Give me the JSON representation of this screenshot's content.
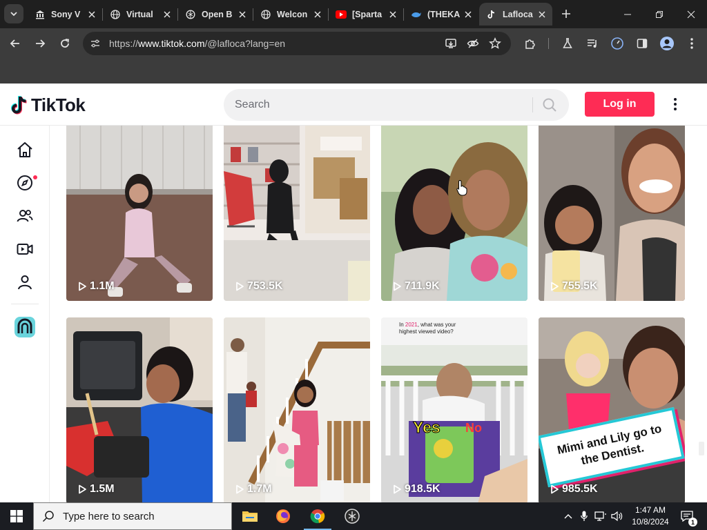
{
  "browser": {
    "tabs": [
      {
        "title": "Sony V",
        "favicon": "bank-icon"
      },
      {
        "title": "Virtual",
        "favicon": "globe-icon"
      },
      {
        "title": "Open B",
        "favicon": "chatgpt-icon"
      },
      {
        "title": "Welcon",
        "favicon": "globe-icon"
      },
      {
        "title": "[Sparta",
        "favicon": "youtube-icon"
      },
      {
        "title": "(THEKA",
        "favicon": "whale-icon"
      },
      {
        "title": "Lafloca",
        "favicon": "tiktok-icon",
        "active": true
      }
    ],
    "url_prefix": "https://",
    "url_domain": "www.tiktok.com",
    "url_path": "/@lafloca?lang=en"
  },
  "tiktok": {
    "logo_text": "TikTok",
    "search_placeholder": "Search",
    "login_label": "Log in"
  },
  "sidebar": {
    "items": [
      "home-icon",
      "explore-icon",
      "following-icon",
      "live-icon",
      "profile-icon",
      "studio-icon"
    ]
  },
  "videos": [
    {
      "views": "1.1M"
    },
    {
      "views": "753.5K"
    },
    {
      "views": "711.9K"
    },
    {
      "views": "755.5K"
    },
    {
      "views": "1.5M"
    },
    {
      "views": "1.7M"
    },
    {
      "views": "918.5K",
      "overlay_line1_pre": "In ",
      "overlay_year": "2021",
      "overlay_line1_post": ", what was your",
      "overlay_line2": "highest viewed video?",
      "overlay_yes": "Yes",
      "overlay_no": "No"
    },
    {
      "views": "985.5K",
      "overlay_caption": "Mimi and Lily go to the Dentist."
    }
  ],
  "taskbar": {
    "search_text": "Type here to search",
    "time": "1:47 AM",
    "date": "10/8/2024",
    "notification_count": "1"
  },
  "colors": {
    "tiktok_red": "#fe2c55",
    "chrome_dark": "#1f1f1f",
    "chrome_toolbar": "#3c3c3c"
  }
}
